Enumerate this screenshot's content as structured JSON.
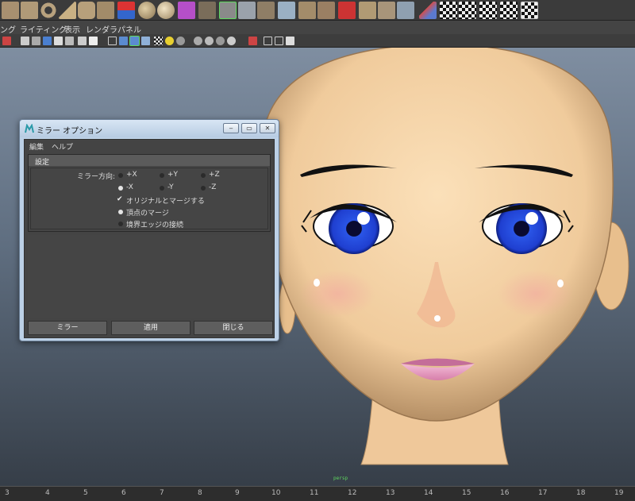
{
  "menubar": {
    "items": [
      "ング",
      "ライティング",
      "表示",
      "レンダラ",
      "パネル"
    ]
  },
  "viewport": {
    "camera_label": "persp"
  },
  "timeline": {
    "ticks": [
      "3",
      "4",
      "5",
      "6",
      "7",
      "8",
      "9",
      "10",
      "11",
      "12",
      "13",
      "14",
      "15",
      "16",
      "17",
      "18",
      "19"
    ]
  },
  "dialog": {
    "title": "ミラー オプション",
    "win_min": "‒",
    "win_max": "▭",
    "win_close": "✕",
    "menu": {
      "edit": "編集",
      "help": "ヘルプ"
    },
    "section_title": "設定",
    "mirror_direction_label": "ミラー方向:",
    "directions": [
      {
        "label": "+X",
        "selected": false
      },
      {
        "label": "+Y",
        "selected": false
      },
      {
        "label": "+Z",
        "selected": false
      },
      {
        "label": "-X",
        "selected": true
      },
      {
        "label": "-Y",
        "selected": false
      },
      {
        "label": "-Z",
        "selected": false
      }
    ],
    "check_mark": "✔",
    "merge_with_original": "オリジナルとマージする",
    "merge_vertices": "頂点のマージ",
    "connect_border_edges": "境界エッジの接続",
    "buttons": {
      "mirror": "ミラー",
      "apply": "適用",
      "close": "閉じる"
    }
  },
  "colors": {
    "accent_green": "#5fd85f",
    "skin": "#f3d1a6",
    "iris": "#1f3fd0"
  }
}
